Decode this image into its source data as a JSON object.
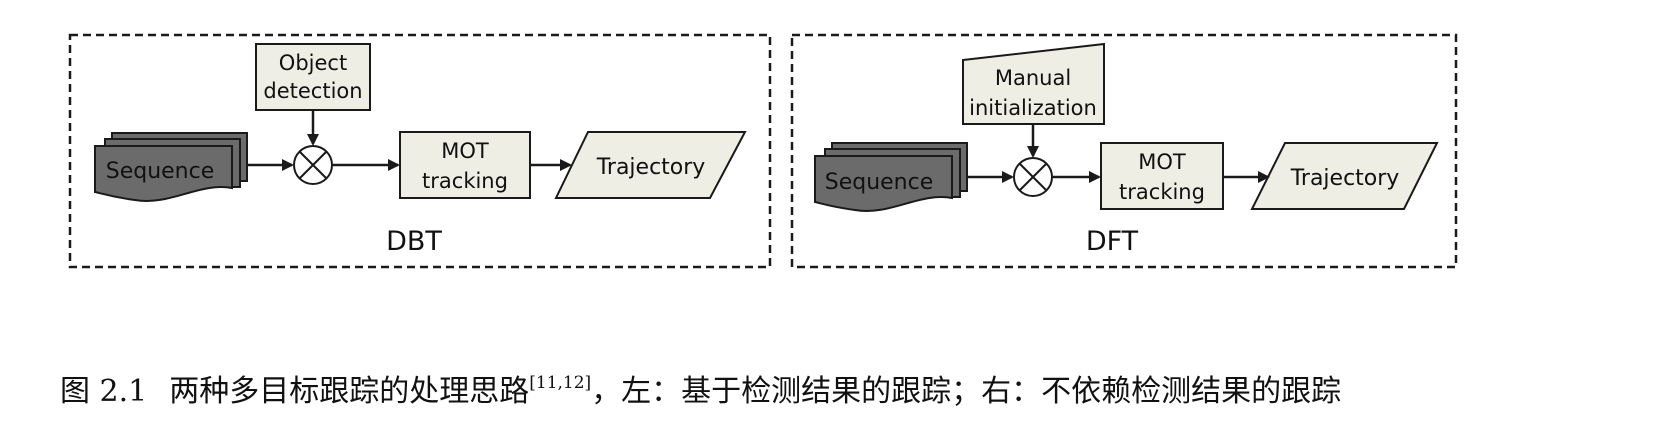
{
  "left_panel": {
    "label": "DBT",
    "sequence": "Sequence",
    "input": [
      "Object",
      "detection"
    ],
    "tracker": [
      "MOT",
      "tracking"
    ],
    "output": "Trajectory"
  },
  "right_panel": {
    "label": "DFT",
    "sequence": "Sequence",
    "input": [
      "Manual",
      "initialization"
    ],
    "tracker": [
      "MOT",
      "tracking"
    ],
    "output": "Trajectory"
  },
  "caption": {
    "number": "图 2.1",
    "text": "两种多目标跟踪的处理思路",
    "citation": "[11,12]",
    "rest": "，左：基于检测结果的跟踪；右：不依赖检测结果的跟踪"
  },
  "colors": {
    "box_fill": "#eeeee4",
    "sequence_fill": "#6b6b6b",
    "stroke": "#1a1a1a"
  }
}
